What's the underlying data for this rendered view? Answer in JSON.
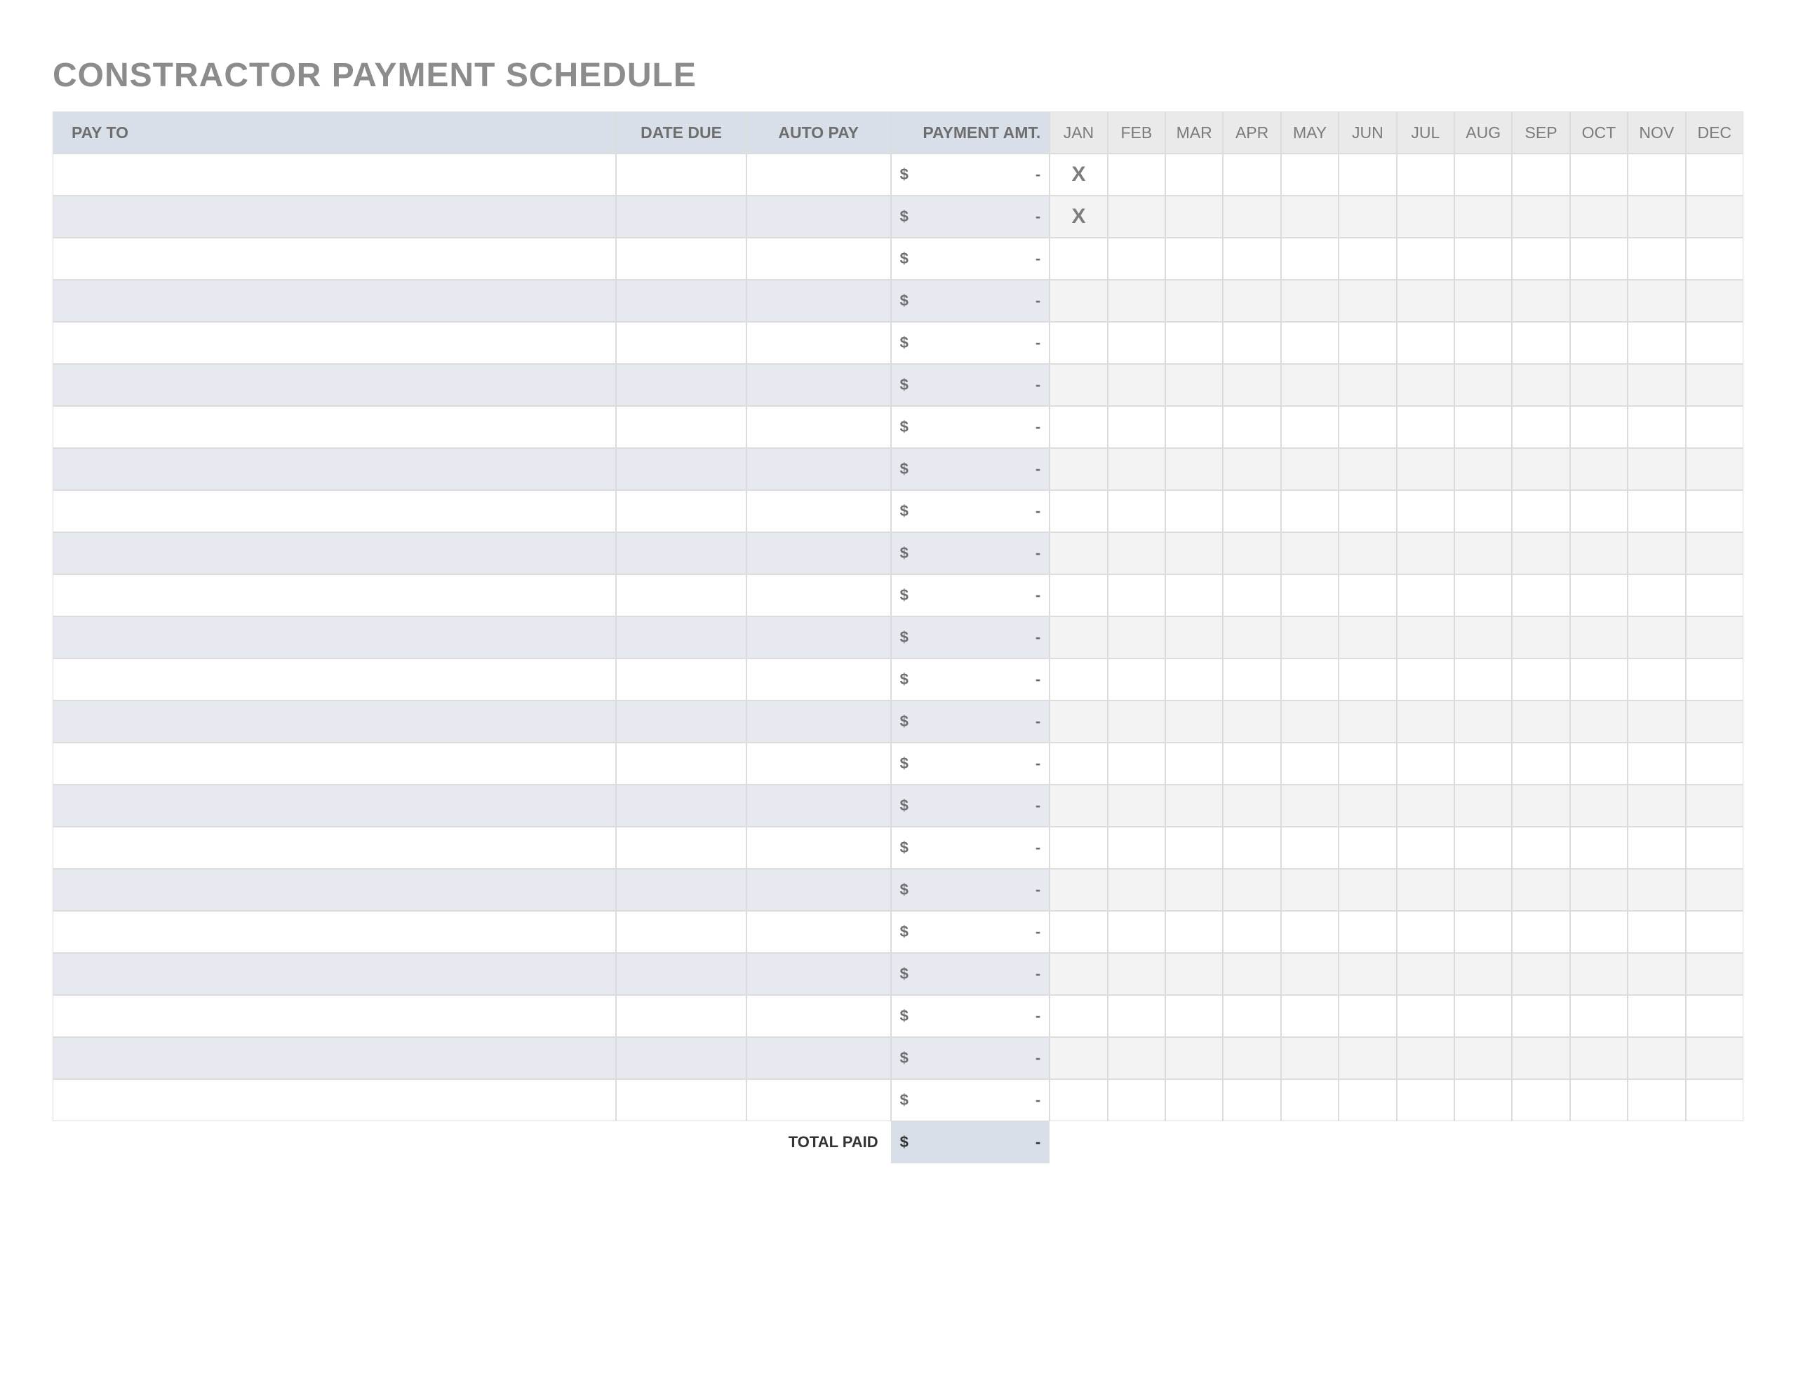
{
  "title": "CONSTRACTOR PAYMENT SCHEDULE",
  "headers": {
    "pay_to": "PAY TO",
    "date_due": "DATE DUE",
    "auto_pay": "AUTO PAY",
    "payment_amt": "PAYMENT AMT."
  },
  "months": [
    "JAN",
    "FEB",
    "MAR",
    "APR",
    "MAY",
    "JUN",
    "JUL",
    "AUG",
    "SEP",
    "OCT",
    "NOV",
    "DEC"
  ],
  "currency_symbol": "$",
  "empty_value": "-",
  "total_label": "TOTAL PAID",
  "total_value": "-",
  "x_mark": "X",
  "rows": [
    {
      "pay_to": "",
      "date_due": "",
      "auto_pay": "",
      "amount": "-",
      "months": [
        "X",
        "",
        "",
        "",
        "",
        "",
        "",
        "",
        "",
        "",
        "",
        ""
      ]
    },
    {
      "pay_to": "",
      "date_due": "",
      "auto_pay": "",
      "amount": "-",
      "months": [
        "X",
        "",
        "",
        "",
        "",
        "",
        "",
        "",
        "",
        "",
        "",
        ""
      ]
    },
    {
      "pay_to": "",
      "date_due": "",
      "auto_pay": "",
      "amount": "-",
      "months": [
        "",
        "",
        "",
        "",
        "",
        "",
        "",
        "",
        "",
        "",
        "",
        ""
      ]
    },
    {
      "pay_to": "",
      "date_due": "",
      "auto_pay": "",
      "amount": "-",
      "months": [
        "",
        "",
        "",
        "",
        "",
        "",
        "",
        "",
        "",
        "",
        "",
        ""
      ]
    },
    {
      "pay_to": "",
      "date_due": "",
      "auto_pay": "",
      "amount": "-",
      "months": [
        "",
        "",
        "",
        "",
        "",
        "",
        "",
        "",
        "",
        "",
        "",
        ""
      ]
    },
    {
      "pay_to": "",
      "date_due": "",
      "auto_pay": "",
      "amount": "-",
      "months": [
        "",
        "",
        "",
        "",
        "",
        "",
        "",
        "",
        "",
        "",
        "",
        ""
      ]
    },
    {
      "pay_to": "",
      "date_due": "",
      "auto_pay": "",
      "amount": "-",
      "months": [
        "",
        "",
        "",
        "",
        "",
        "",
        "",
        "",
        "",
        "",
        "",
        ""
      ]
    },
    {
      "pay_to": "",
      "date_due": "",
      "auto_pay": "",
      "amount": "-",
      "months": [
        "",
        "",
        "",
        "",
        "",
        "",
        "",
        "",
        "",
        "",
        "",
        ""
      ]
    },
    {
      "pay_to": "",
      "date_due": "",
      "auto_pay": "",
      "amount": "-",
      "months": [
        "",
        "",
        "",
        "",
        "",
        "",
        "",
        "",
        "",
        "",
        "",
        ""
      ]
    },
    {
      "pay_to": "",
      "date_due": "",
      "auto_pay": "",
      "amount": "-",
      "months": [
        "",
        "",
        "",
        "",
        "",
        "",
        "",
        "",
        "",
        "",
        "",
        ""
      ]
    },
    {
      "pay_to": "",
      "date_due": "",
      "auto_pay": "",
      "amount": "-",
      "months": [
        "",
        "",
        "",
        "",
        "",
        "",
        "",
        "",
        "",
        "",
        "",
        ""
      ]
    },
    {
      "pay_to": "",
      "date_due": "",
      "auto_pay": "",
      "amount": "-",
      "months": [
        "",
        "",
        "",
        "",
        "",
        "",
        "",
        "",
        "",
        "",
        "",
        ""
      ]
    },
    {
      "pay_to": "",
      "date_due": "",
      "auto_pay": "",
      "amount": "-",
      "months": [
        "",
        "",
        "",
        "",
        "",
        "",
        "",
        "",
        "",
        "",
        "",
        ""
      ]
    },
    {
      "pay_to": "",
      "date_due": "",
      "auto_pay": "",
      "amount": "-",
      "months": [
        "",
        "",
        "",
        "",
        "",
        "",
        "",
        "",
        "",
        "",
        "",
        ""
      ]
    },
    {
      "pay_to": "",
      "date_due": "",
      "auto_pay": "",
      "amount": "-",
      "months": [
        "",
        "",
        "",
        "",
        "",
        "",
        "",
        "",
        "",
        "",
        "",
        ""
      ]
    },
    {
      "pay_to": "",
      "date_due": "",
      "auto_pay": "",
      "amount": "-",
      "months": [
        "",
        "",
        "",
        "",
        "",
        "",
        "",
        "",
        "",
        "",
        "",
        ""
      ]
    },
    {
      "pay_to": "",
      "date_due": "",
      "auto_pay": "",
      "amount": "-",
      "months": [
        "",
        "",
        "",
        "",
        "",
        "",
        "",
        "",
        "",
        "",
        "",
        ""
      ]
    },
    {
      "pay_to": "",
      "date_due": "",
      "auto_pay": "",
      "amount": "-",
      "months": [
        "",
        "",
        "",
        "",
        "",
        "",
        "",
        "",
        "",
        "",
        "",
        ""
      ]
    },
    {
      "pay_to": "",
      "date_due": "",
      "auto_pay": "",
      "amount": "-",
      "months": [
        "",
        "",
        "",
        "",
        "",
        "",
        "",
        "",
        "",
        "",
        "",
        ""
      ]
    },
    {
      "pay_to": "",
      "date_due": "",
      "auto_pay": "",
      "amount": "-",
      "months": [
        "",
        "",
        "",
        "",
        "",
        "",
        "",
        "",
        "",
        "",
        "",
        ""
      ]
    },
    {
      "pay_to": "",
      "date_due": "",
      "auto_pay": "",
      "amount": "-",
      "months": [
        "",
        "",
        "",
        "",
        "",
        "",
        "",
        "",
        "",
        "",
        "",
        ""
      ]
    },
    {
      "pay_to": "",
      "date_due": "",
      "auto_pay": "",
      "amount": "-",
      "months": [
        "",
        "",
        "",
        "",
        "",
        "",
        "",
        "",
        "",
        "",
        "",
        ""
      ]
    },
    {
      "pay_to": "",
      "date_due": "",
      "auto_pay": "",
      "amount": "-",
      "months": [
        "",
        "",
        "",
        "",
        "",
        "",
        "",
        "",
        "",
        "",
        "",
        ""
      ]
    }
  ]
}
